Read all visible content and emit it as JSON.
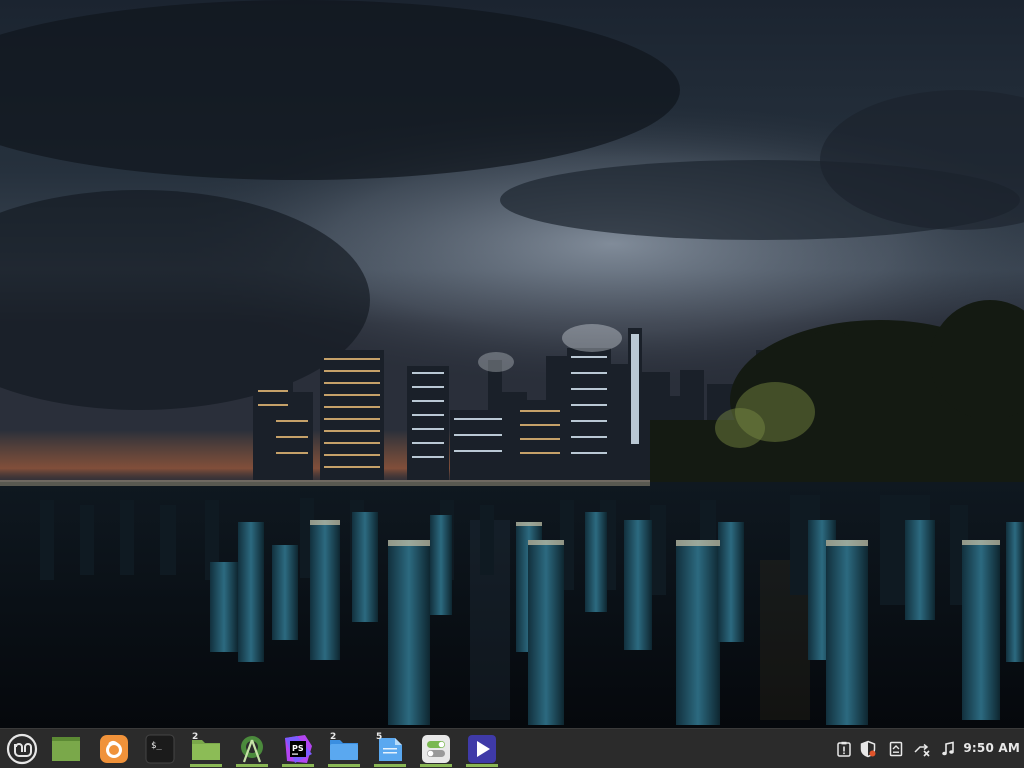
{
  "desktop": {
    "wallpaper": "night-city-skyline-over-river-pilings"
  },
  "panel": {
    "menu": {
      "icon": "linux-mint-menu-icon"
    },
    "launchers": [
      {
        "name": "show-desktop",
        "icon": "desktop-icon",
        "running": false,
        "count": ""
      },
      {
        "name": "firefox",
        "icon": "firefox-icon",
        "running": false,
        "count": ""
      },
      {
        "name": "terminal",
        "icon": "terminal-icon",
        "running": false,
        "count": "",
        "glyph": "$_"
      },
      {
        "name": "files",
        "icon": "folder-icon",
        "running": true,
        "count": "2"
      },
      {
        "name": "android-studio",
        "icon": "android-studio-icon",
        "running": true,
        "count": ""
      },
      {
        "name": "phpstorm",
        "icon": "phpstorm-icon",
        "running": true,
        "count": "",
        "glyph": "PS"
      },
      {
        "name": "file-manager-blue",
        "icon": "blue-folder-icon",
        "running": true,
        "count": "2"
      },
      {
        "name": "text-editor",
        "icon": "text-editor-icon",
        "running": true,
        "count": "5"
      },
      {
        "name": "settings",
        "icon": "toggle-settings-icon",
        "running": true,
        "count": ""
      },
      {
        "name": "media-player",
        "icon": "media-player-icon",
        "running": true,
        "count": ""
      }
    ],
    "tray": [
      {
        "name": "update-manager",
        "icon": "update-manager-icon"
      },
      {
        "name": "security",
        "icon": "shield-icon"
      },
      {
        "name": "notes",
        "icon": "notes-icon"
      },
      {
        "name": "network",
        "icon": "network-disconnected-icon"
      },
      {
        "name": "sound",
        "icon": "music-note-icon"
      }
    ],
    "clock": "9:50 AM"
  }
}
